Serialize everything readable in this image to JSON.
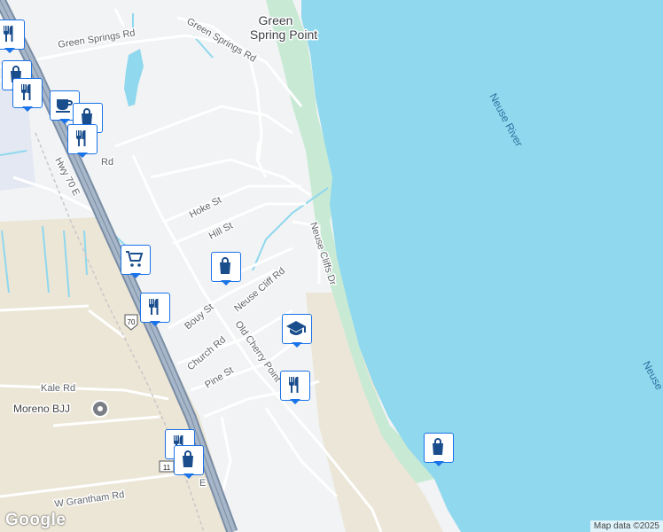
{
  "map": {
    "colors": {
      "water": "#8fd8ee",
      "land": "#f1f3f4",
      "park": "#c8ead4",
      "sand": "#ece6d6",
      "highway": "#9aa7b7",
      "road": "#ffffff"
    },
    "labels": {
      "green_spring_point": [
        "Green",
        "Spring Point"
      ],
      "neuse_river": "Neuse River",
      "neuse_edge": "Neuse",
      "green_springs_rd_1": "Green Springs Rd",
      "green_springs_rd_2": "Green Springs Rd",
      "hwy_70_e": "Hwy 70 E",
      "rd_fragment": "Rd",
      "hoke_st": "Hoke St",
      "hill_st": "Hill St",
      "neuse_cliffs_dr": "Neuse Cliffs Dr",
      "neuse_cliff_rd": "Neuse Cliff Rd",
      "bouy_st": "Bouy St",
      "church_rd": "Church Rd",
      "old_cherry_point": "Old Cherry Point",
      "pine_st": "Pine St",
      "kale_rd": "Kale Rd",
      "w_grantham_rd": "W Grantham Rd",
      "e_fragment": "E",
      "shield_70": "70",
      "shield_11": "11"
    },
    "places": {
      "moreno_bjj": "Moreno BJJ"
    },
    "pins": [
      {
        "icon": "restaurant-icon"
      },
      {
        "icon": "shopping-bag-icon"
      },
      {
        "icon": "restaurant-icon"
      },
      {
        "icon": "coffee-icon"
      },
      {
        "icon": "shopping-bag-icon"
      },
      {
        "icon": "restaurant-icon"
      },
      {
        "icon": "shopping-cart-icon"
      },
      {
        "icon": "shopping-bag-icon"
      },
      {
        "icon": "restaurant-icon"
      },
      {
        "icon": "school-icon"
      },
      {
        "icon": "restaurant-icon"
      },
      {
        "icon": "restaurant-icon"
      },
      {
        "icon": "shopping-bag-icon"
      },
      {
        "icon": "shopping-bag-icon"
      }
    ]
  },
  "footer": {
    "google_logo": "Google",
    "attribution": "Map data ©2025"
  }
}
